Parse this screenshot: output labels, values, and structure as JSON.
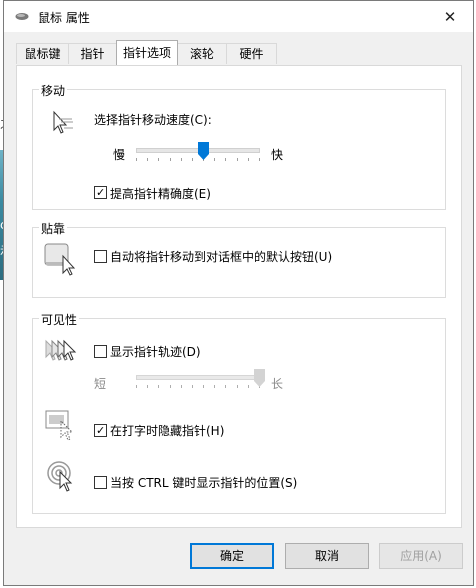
{
  "window": {
    "title": "鼠标 属性",
    "close_glyph": "✕"
  },
  "background": {
    "glyph1": "之",
    "glyph2": "c",
    "glyph3": "示"
  },
  "tabs": [
    {
      "label": "鼠标键",
      "active": false
    },
    {
      "label": "指针",
      "active": false
    },
    {
      "label": "指针选项",
      "active": true
    },
    {
      "label": "滚轮",
      "active": false
    },
    {
      "label": "硬件",
      "active": false
    }
  ],
  "motion": {
    "group_label": "移动",
    "speed_label": "选择指针移动速度(C):",
    "slow_label": "慢",
    "fast_label": "快",
    "speed_value": 6,
    "speed_max": 11,
    "precision_label": "提高指针精确度(E)",
    "precision_checked": true
  },
  "snap": {
    "group_label": "贴靠",
    "snap_label": "自动将指针移动到对话框中的默认按钮(U)",
    "snap_checked": false
  },
  "visibility": {
    "group_label": "可见性",
    "trails_label": "显示指针轨迹(D)",
    "trails_checked": false,
    "short_label": "短",
    "long_label": "长",
    "trails_value": 11,
    "trails_max": 11,
    "hide_label": "在打字时隐藏指针(H)",
    "hide_checked": true,
    "ctrl_label": "当按 CTRL 键时显示指针的位置(S)",
    "ctrl_checked": false
  },
  "buttons": {
    "ok": "确定",
    "cancel": "取消",
    "apply": "应用(A)"
  },
  "colors": {
    "accent": "#0078d7",
    "thumb_active": "#0078d7",
    "thumb_disabled": "#cccccc"
  },
  "icons": [
    "mouse-icon",
    "close-icon",
    "pointer-speed-icon",
    "snap-to-icon",
    "pointer-trails-icon",
    "hide-pointer-icon",
    "show-location-icon"
  ]
}
